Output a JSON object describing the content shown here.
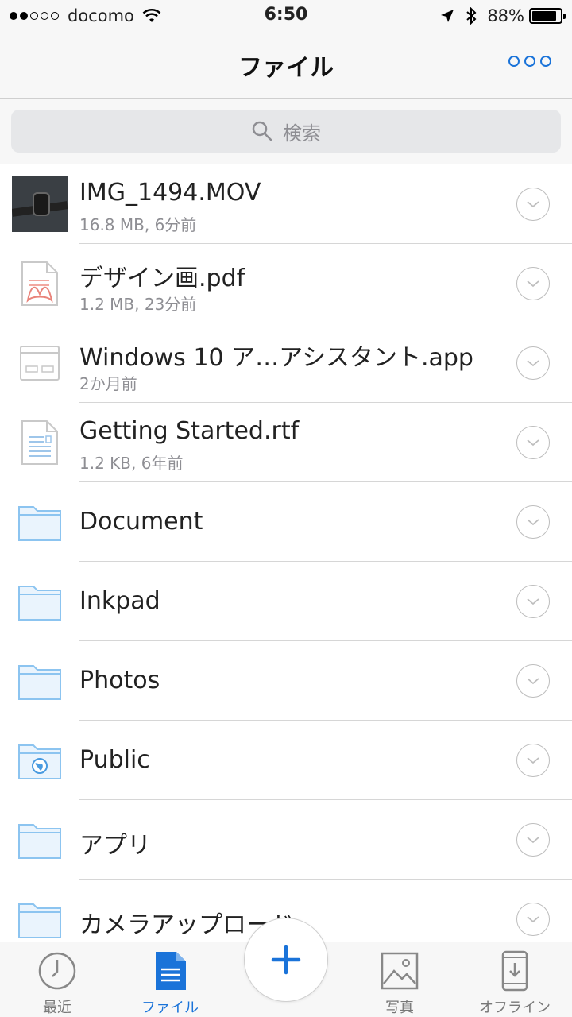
{
  "status_bar": {
    "carrier": "docomo",
    "time": "6:50",
    "battery": "88%",
    "battery_level": 0.88,
    "signal_bars": 2
  },
  "header": {
    "title": "ファイル",
    "more_icon": "more-icon"
  },
  "search": {
    "placeholder": "検索",
    "icon": "search-icon"
  },
  "files": [
    {
      "name": "IMG_1494.MOV",
      "meta": "16.8 MB, 6分前",
      "icon": "video-thumbnail"
    },
    {
      "name": "デザイン画.pdf",
      "meta": "1.2 MB, 23分前",
      "icon": "pdf-icon"
    },
    {
      "name": "Windows 10 ア…アシスタント.app",
      "meta": "2か月前",
      "icon": "app-icon"
    },
    {
      "name": "Getting Started.rtf",
      "meta": "1.2 KB, 6年前",
      "icon": "document-icon"
    },
    {
      "name": "Document",
      "icon": "folder-icon"
    },
    {
      "name": "Inkpad",
      "icon": "folder-icon"
    },
    {
      "name": "Photos",
      "icon": "folder-icon"
    },
    {
      "name": "Public",
      "icon": "public-folder-icon"
    },
    {
      "name": "アプリ",
      "icon": "folder-icon"
    },
    {
      "name": "カメラアップロード",
      "icon": "folder-icon"
    }
  ],
  "tabs": [
    {
      "label": "最近",
      "icon": "clock-icon"
    },
    {
      "label": "ファイル",
      "icon": "file-icon",
      "active": true
    },
    {
      "label": "写真",
      "icon": "photo-icon"
    },
    {
      "label": "オフライン",
      "icon": "offline-icon"
    }
  ],
  "fab_icon": "plus-icon",
  "colors": {
    "accent": "#1a73d9",
    "folder": "#8cc4f0",
    "secondary_text": "#8e8e93"
  }
}
